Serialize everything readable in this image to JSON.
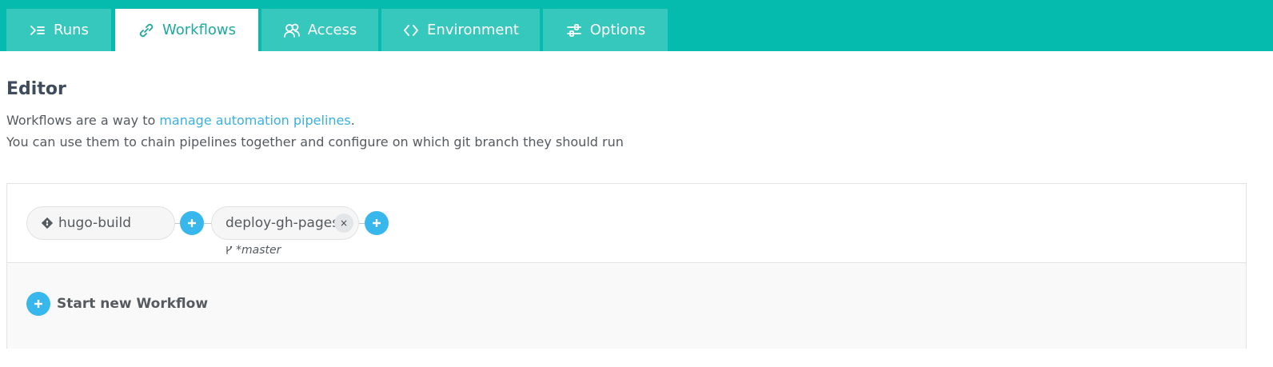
{
  "tabs": [
    {
      "label": "Runs",
      "icon": "runs-icon",
      "active": false
    },
    {
      "label": "Workflows",
      "icon": "workflow-link-icon",
      "active": true
    },
    {
      "label": "Access",
      "icon": "users-icon",
      "active": false
    },
    {
      "label": "Environment",
      "icon": "code-brackets-icon",
      "active": false
    },
    {
      "label": "Options",
      "icon": "sliders-icon",
      "active": false
    }
  ],
  "editor": {
    "title": "Editor",
    "desc_prefix": "Workflows are a way to ",
    "desc_link": "manage automation pipelines",
    "desc_suffix": ".",
    "desc_line2": "You can use them to chain pipelines together and configure on which git branch they should run"
  },
  "workflow": {
    "nodes": [
      {
        "name": "hugo-build",
        "icon": "git-icon"
      },
      {
        "name": "deploy-gh-pages",
        "remove_label": "×"
      }
    ],
    "branch_filter": "*master",
    "start_new_label": "Start new Workflow"
  },
  "colors": {
    "tabbar": "#04bbae",
    "tab_inactive": "#36c8bd",
    "tab_active_text": "#1fa89e",
    "accent_blue": "#38b7ec",
    "link": "#3ab0e2"
  }
}
